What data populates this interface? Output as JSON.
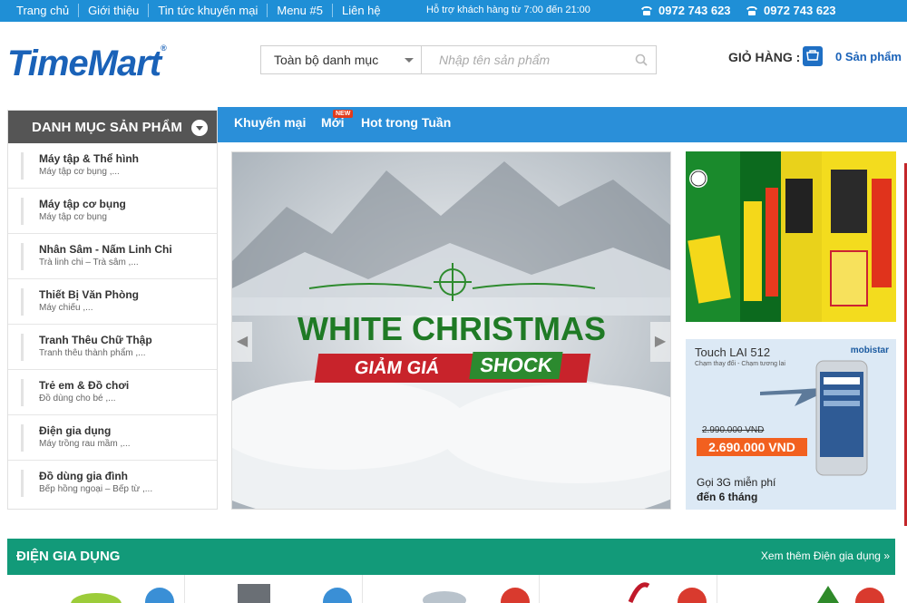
{
  "topbar": {
    "menu": [
      "Trang chủ",
      "Giới thiệu",
      "Tin tức khuyến mại",
      "Menu #5",
      "Liên hệ"
    ],
    "support": "Hỗ trợ khách hàng từ 7:00 đến 21:00",
    "phone1": "0972 743 623",
    "phone2": "0972 743 623"
  },
  "header": {
    "logo": "TimeMart",
    "category_select": "Toàn bộ danh mục",
    "search_placeholder": "Nhập tên sản phẩm",
    "cart_label": "GIỎ HÀNG :",
    "cart_count": "0 Sản phẩm"
  },
  "nav": {
    "items": [
      "Khuyến mại",
      "Mới",
      "Hot trong Tuần"
    ],
    "new_badge": "NEW"
  },
  "sidebar": {
    "title": "DANH MỤC SẢN PHẨM",
    "items": [
      {
        "title": "Máy tập & Thể hình",
        "sub": "Máy tập cơ bụng ,..."
      },
      {
        "title": "Máy tập cơ bụng",
        "sub": "Máy tập cơ bụng"
      },
      {
        "title": "Nhân Sâm - Nấm Linh Chi",
        "sub": "Trà linh chi – Trà sâm ,..."
      },
      {
        "title": "Thiết Bị Văn Phòng",
        "sub": "Máy chiếu ,..."
      },
      {
        "title": "Tranh Thêu Chữ Thập",
        "sub": "Tranh thêu thành phẩm ,..."
      },
      {
        "title": "Trẻ em & Đồ chơi",
        "sub": "Đồ dùng cho bé ,..."
      },
      {
        "title": "Điện gia dụng",
        "sub": "Máy trồng rau mầm ,..."
      },
      {
        "title": "Đồ dùng gia đình",
        "sub": "Bếp hồng ngoại – Bếp từ ,..."
      }
    ]
  },
  "slider": {
    "title": "WHITE CHRISTMAS",
    "subtitle_a": "GIẢM GIÁ",
    "subtitle_b": "SHOCK"
  },
  "ad2": {
    "brand": "Touch LAI 512",
    "maker": "mobistar",
    "tagline": "Chạm thay đổi - Chạm tương lai",
    "old_price": "2.990.000 VND",
    "new_price": "2.690.000 VND",
    "promo_line1": "Gọi 3G miễn phí",
    "promo_line2": "đến 6 tháng"
  },
  "section": {
    "title": "ĐIỆN GIA DỤNG",
    "more": "Xem thêm Điện gia dụng »"
  },
  "colors": {
    "topbar": "#1f8fd6",
    "navbar": "#2a8fd9",
    "section": "#129a79",
    "sidebar_head": "#555555",
    "logo": "#1a62b8"
  }
}
